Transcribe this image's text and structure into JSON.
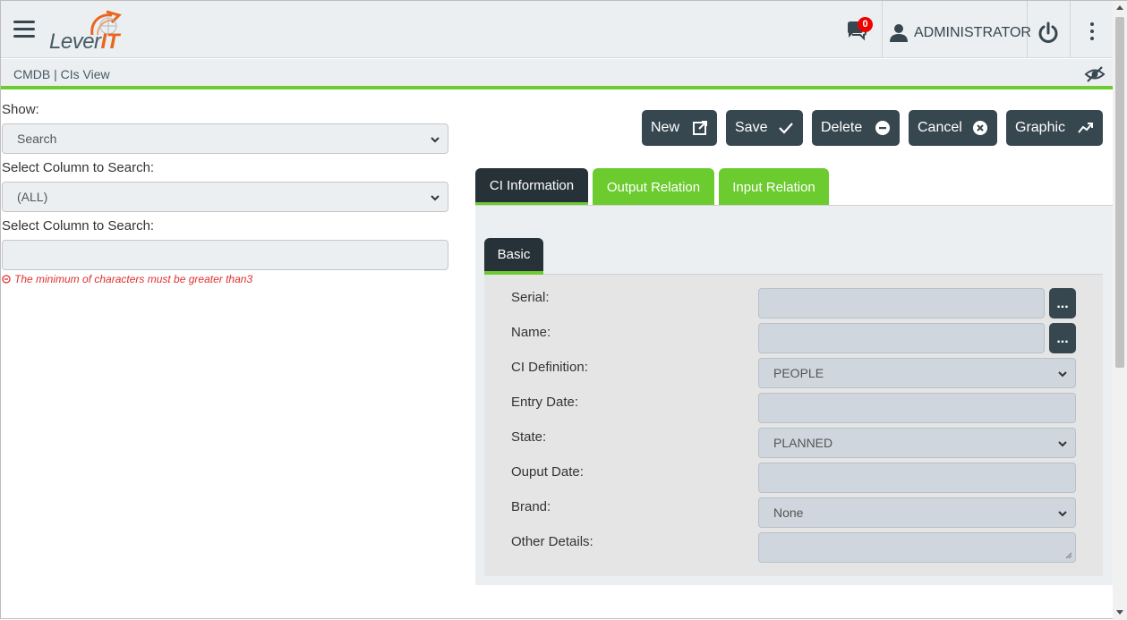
{
  "header": {
    "logo_text_main": "Lever",
    "logo_text_accent": "IT",
    "notifications_count": "0",
    "user_name": "ADMINISTRATOR"
  },
  "breadcrumb": "CMDB | CIs View",
  "search_panel": {
    "show_label": "Show:",
    "show_value": "Search",
    "column_label": "Select Column to Search:",
    "column_value": "(ALL)",
    "search_label": "Select Column to Search:",
    "search_value": "",
    "error_text": "The minimum of characters must be greater than3"
  },
  "toolbar": {
    "new_label": "New",
    "save_label": "Save",
    "delete_label": "Delete",
    "cancel_label": "Cancel",
    "graphic_label": "Graphic"
  },
  "tabs": [
    {
      "label": "CI Information"
    },
    {
      "label": "Output Relation"
    },
    {
      "label": "Input Relation"
    }
  ],
  "subtab": "Basic",
  "form": {
    "serial_label": "Serial:",
    "serial_value": "",
    "name_label": "Name:",
    "name_value": "",
    "ci_definition_label": "CI Definition:",
    "ci_definition_value": "PEOPLE",
    "entry_date_label": "Entry Date:",
    "entry_date_value": "",
    "state_label": "State:",
    "state_value": "PLANNED",
    "output_date_label": "Ouput Date:",
    "output_date_value": "",
    "brand_label": "Brand:",
    "brand_value": "None",
    "other_details_label": "Other Details:",
    "other_details_value": "",
    "lookup_button": "..."
  },
  "colors": {
    "accent_green": "#6ccb2f",
    "dark": "#37474f",
    "darker": "#263238",
    "logo_orange": "#e8661d",
    "error_red": "#e03030"
  },
  "icons": [
    "menu-icon",
    "chat-bubble-icon",
    "user-icon",
    "power-icon",
    "kebab-icon",
    "eye-slash-icon",
    "external-link-icon",
    "check-icon",
    "minus-circle-icon",
    "close-circle-icon",
    "trend-up-icon",
    "chevron-down-icon"
  ]
}
